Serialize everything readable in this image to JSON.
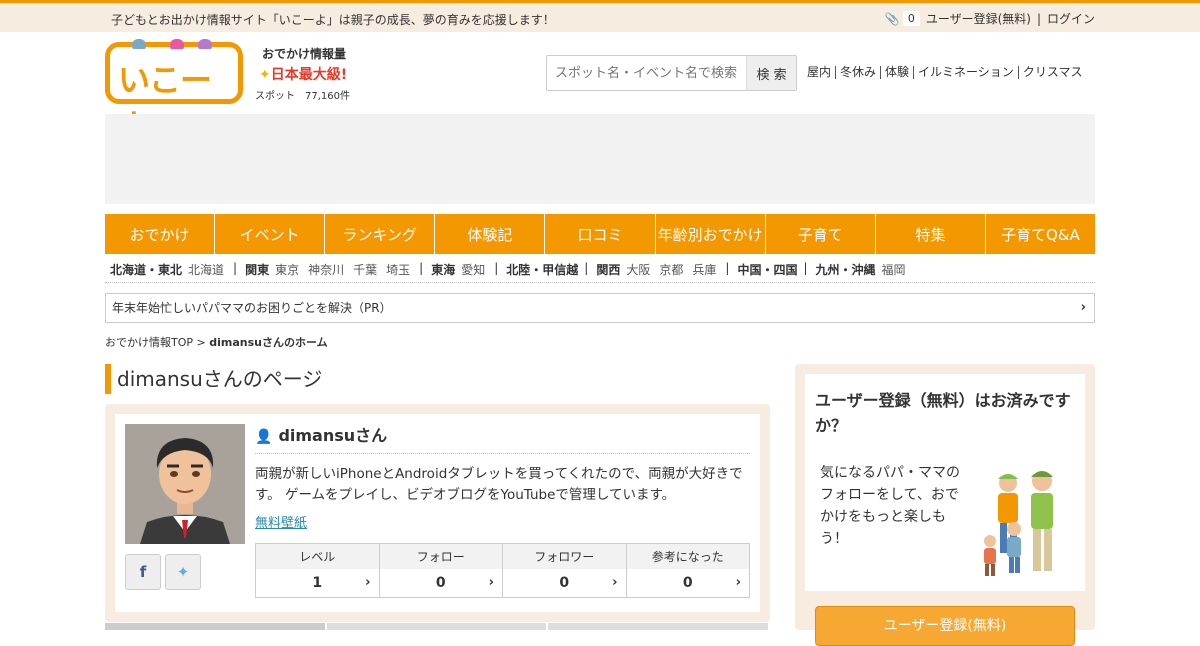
{
  "top_bar": {
    "tagline": "子どもとお出かけ情報サイト「いこーよ」は親子の成長、夢の育みを応援します！",
    "clip_count": "0",
    "register_link": "ユーザー登録(無料)",
    "separator": "|",
    "login_link": "ログイン"
  },
  "logo": {
    "text": "いこーよ",
    "badge_line1": "おでかけ情報量",
    "badge_line2": "日本最大級",
    "spots": "スポット　77,160件"
  },
  "search": {
    "placeholder": "スポット名・イベント名で検索",
    "button": "検 索"
  },
  "quick_links": [
    "屋内",
    "冬休み",
    "体験",
    "イルミネーション",
    "クリスマス"
  ],
  "nav": [
    "おでかけ",
    "イベント",
    "ランキング",
    "体験記",
    "口コミ",
    "年齢別おでかけ",
    "子育て",
    "特集",
    "子育てQ&A"
  ],
  "regions": [
    {
      "name": "北海道・東北",
      "prefs": [
        "北海道"
      ]
    },
    {
      "name": "関東",
      "prefs": [
        "東京",
        "神奈川",
        "千葉",
        "埼玉"
      ]
    },
    {
      "name": "東海",
      "prefs": [
        "愛知"
      ]
    },
    {
      "name": "北陸・甲信越",
      "prefs": []
    },
    {
      "name": "関西",
      "prefs": [
        "大阪",
        "京都",
        "兵庫"
      ]
    },
    {
      "name": "中国・四国",
      "prefs": []
    },
    {
      "name": "九州・沖縄",
      "prefs": [
        "福岡"
      ]
    }
  ],
  "pr_bar": "年末年始忙しいパパママのお困りごとを解決（PR）",
  "breadcrumb": {
    "home": "おでかけ情報TOP",
    "separator": ">",
    "current": "dimansuさんのホーム"
  },
  "page_title": "dimansuさんのページ",
  "profile": {
    "name": "dimansuさん",
    "bio": "両親が新しいiPhoneとAndroidタブレットを買ってくれたので、両親が大好きです。 ゲームをプレイし、ビデオブログをYouTubeで管理しています。",
    "wallpaper_link": "無料壁紙",
    "stats": [
      {
        "label": "レベル",
        "value": "1"
      },
      {
        "label": "フォロー",
        "value": "0"
      },
      {
        "label": "フォロワー",
        "value": "0"
      },
      {
        "label": "参考になった",
        "value": "0"
      }
    ]
  },
  "sidebar": {
    "title": "ユーザー登録（無料）はお済みですか？",
    "text": "気になるパパ・ママのフォローをして、おでかけをもっと楽しもう！",
    "button": "ユーザー登録(無料)"
  },
  "colors": {
    "accent": "#f39800",
    "link": "#2a8aa8",
    "panel_bg": "#f8ece0"
  }
}
